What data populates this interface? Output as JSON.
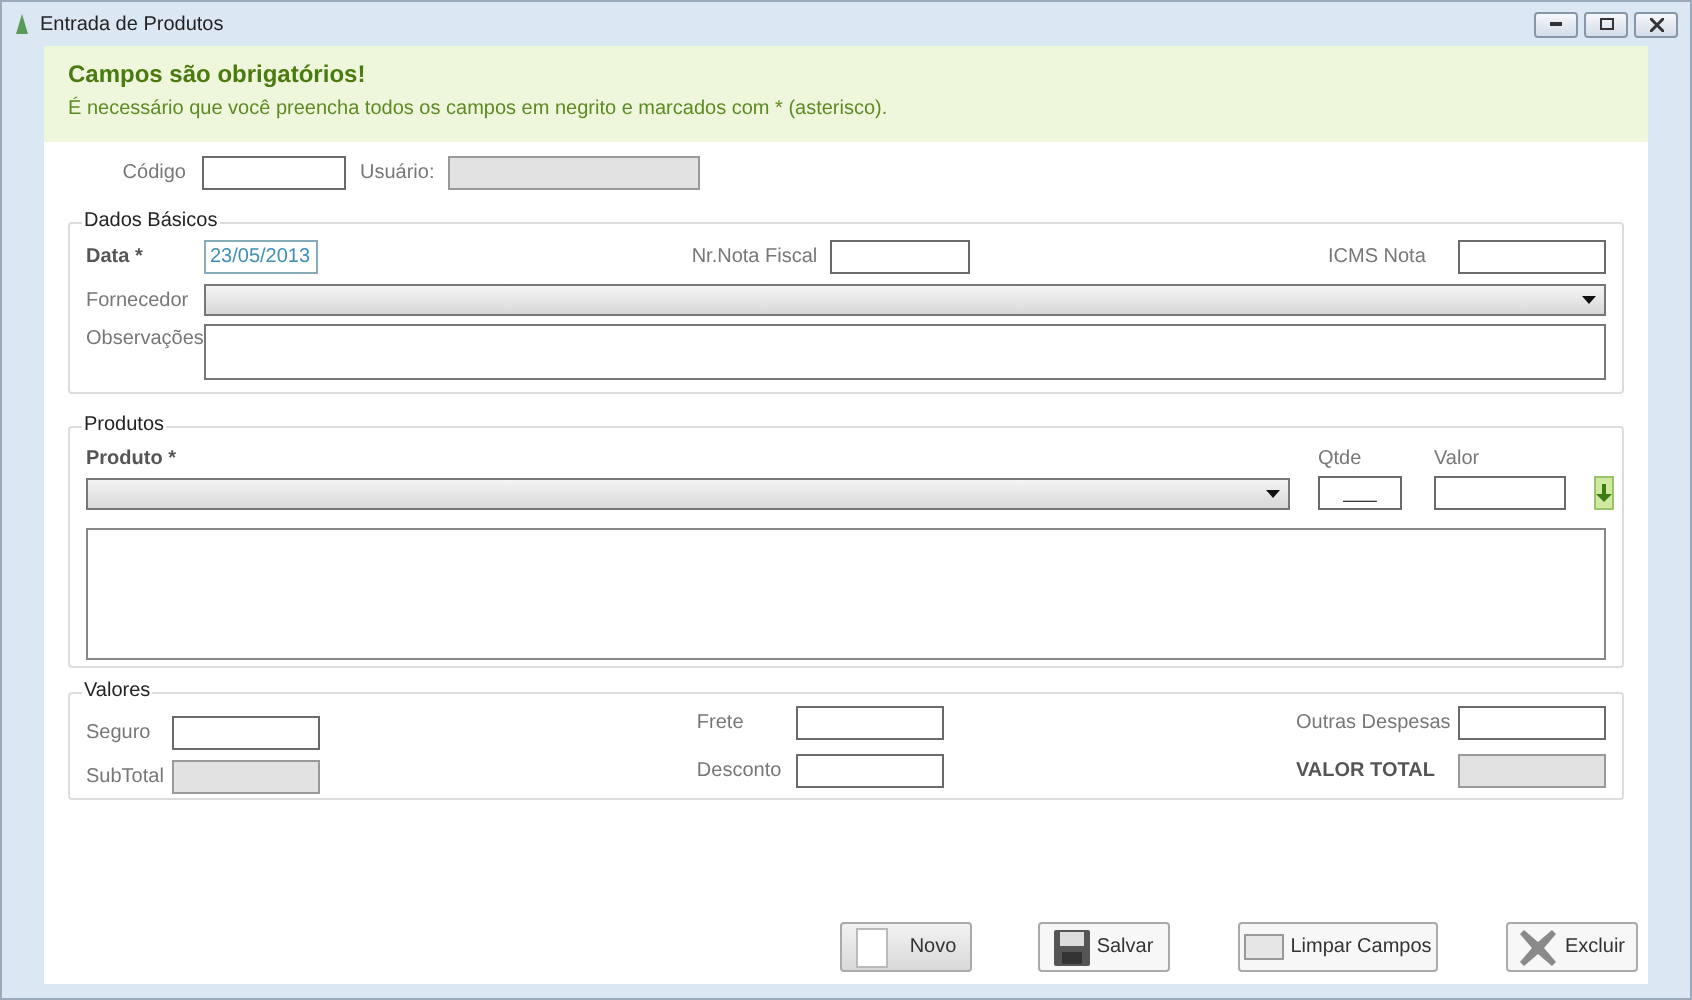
{
  "window": {
    "title": "Entrada de Produtos"
  },
  "banner": {
    "title": "Campos são obrigatórios!",
    "message": "É necessário que você preencha todos os campos em negrito e marcados com * (asterisco)."
  },
  "header_fields": [
    {
      "label": "Código",
      "required": false,
      "disabled": false
    },
    {
      "label": "Usuário:",
      "required": false,
      "disabled": true
    }
  ],
  "dados_basicos": {
    "legend": "Dados Básicos",
    "data": {
      "label": "Data *",
      "required": true,
      "disabled": false,
      "value": "23/05/2013"
    },
    "nr_nota_fiscal": {
      "label": "Nr.Nota Fiscal",
      "required": false,
      "disabled": false
    },
    "icms_nota": {
      "label": "ICMS Nota",
      "required": false,
      "disabled": false
    },
    "fornecedor": {
      "label": "Fornecedor",
      "required": false,
      "disabled": false
    },
    "observacoes": {
      "label": "Observações",
      "required": false,
      "disabled": false
    }
  },
  "produtos": {
    "legend": "Produtos",
    "produto": {
      "label": "Produto *",
      "required": true,
      "disabled": false
    },
    "qtde": {
      "label": "Qtde",
      "required": false,
      "disabled": false,
      "value": "___"
    },
    "valor": {
      "label": "Valor",
      "required": false,
      "disabled": false
    }
  },
  "valores": {
    "legend": "Valores",
    "columns": [
      [
        {
          "label": "Seguro",
          "required": false,
          "disabled": false
        },
        {
          "label": "SubTotal",
          "required": false,
          "disabled": true
        }
      ],
      [
        {
          "label": "Frete",
          "required": false,
          "disabled": false
        },
        {
          "label": "Desconto",
          "required": false,
          "disabled": false
        }
      ],
      [
        {
          "label": "Outras Despesas",
          "required": false,
          "disabled": false
        },
        {
          "label": "VALOR TOTAL",
          "required": true,
          "disabled": true
        }
      ]
    ]
  },
  "buttons": [
    {
      "label": "Novo",
      "kind": "new"
    },
    {
      "label": "Salvar",
      "kind": "save"
    },
    {
      "label": "Limpar Campos",
      "kind": "clear"
    },
    {
      "label": "Excluir",
      "kind": "delete"
    }
  ]
}
